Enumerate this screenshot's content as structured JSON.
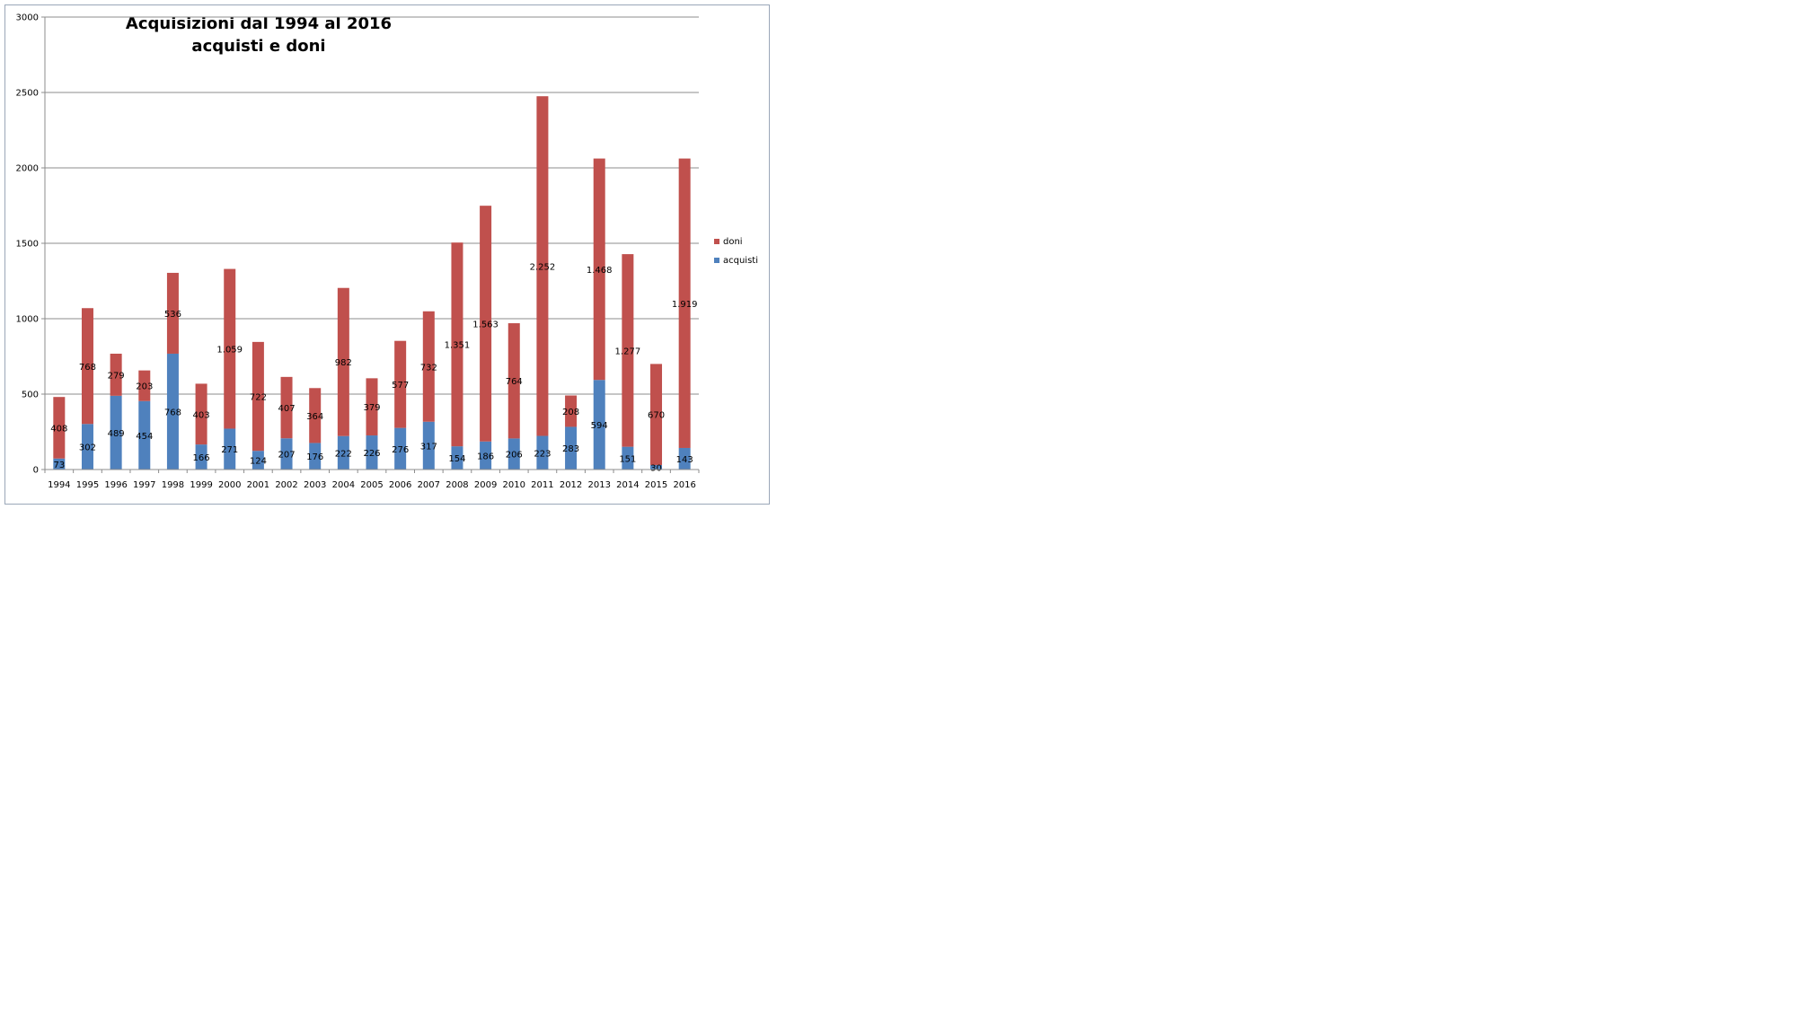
{
  "chart_data": {
    "type": "bar",
    "stacked": true,
    "title": "Acquisizioni dal 1994 al 2016",
    "subtitle": "acquisti e doni",
    "categories": [
      "1994",
      "1995",
      "1996",
      "1997",
      "1998",
      "1999",
      "2000",
      "2001",
      "2002",
      "2003",
      "2004",
      "2005",
      "2006",
      "2007",
      "2008",
      "2009",
      "2010",
      "2011",
      "2012",
      "2013",
      "2014",
      "2015",
      "2016"
    ],
    "series": [
      {
        "name": "acquisti",
        "color": "#4f81bd",
        "values": [
          73,
          302,
          489,
          454,
          768,
          166,
          271,
          124,
          207,
          176,
          222,
          226,
          276,
          317,
          154,
          186,
          206,
          223,
          283,
          594,
          151,
          30,
          143
        ],
        "labels": [
          "73",
          "302",
          "489",
          "454",
          "768",
          "166",
          "271",
          "124",
          "207",
          "176",
          "222",
          "226",
          "276",
          "317",
          "154",
          "186",
          "206",
          "223",
          "283",
          "594",
          "151",
          "30",
          "143"
        ]
      },
      {
        "name": "doni",
        "color": "#c0504d",
        "values": [
          408,
          768,
          279,
          203,
          536,
          403,
          1059,
          722,
          407,
          364,
          982,
          379,
          577,
          732,
          1351,
          1563,
          764,
          2252,
          208,
          1468,
          1277,
          670,
          1919
        ],
        "labels": [
          "408",
          "768",
          "279",
          "203",
          "536",
          "403",
          "1.059",
          "722",
          "407",
          "364",
          "982",
          "379",
          "577",
          "732",
          "1.351",
          "1.563",
          "764",
          "2.252",
          "208",
          "1.468",
          "1.277",
          "670",
          "1.919"
        ]
      }
    ],
    "yticks": [
      "0",
      "500",
      "1000",
      "1500",
      "2000",
      "2500",
      "3000"
    ],
    "ylim": [
      0,
      3000
    ],
    "grid": true,
    "legend": "right",
    "legend_order": [
      "doni",
      "acquisti"
    ]
  }
}
